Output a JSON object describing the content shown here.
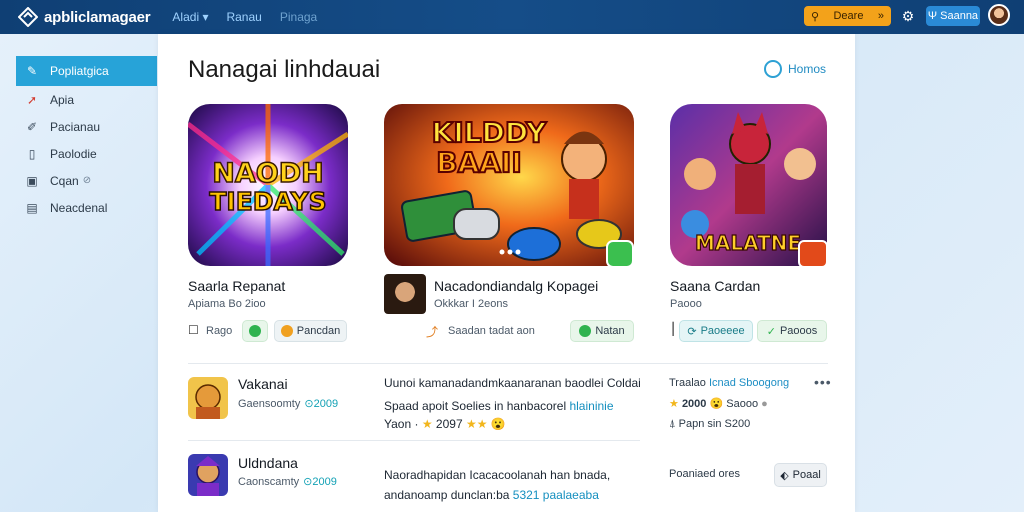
{
  "topbar": {
    "brand": "apbliclamagaer",
    "nav": [
      "Aladi",
      "Ranau",
      "Pinaga"
    ],
    "search_label": "Deare",
    "user_label": "Saanna"
  },
  "sidebar": {
    "items": [
      {
        "label": "Popliatgica",
        "icon": "pencil-icon"
      },
      {
        "label": "Apia",
        "icon": "arrow-icon"
      },
      {
        "label": "Pacianau",
        "icon": "edit-icon"
      },
      {
        "label": "Paolodie",
        "icon": "document-icon"
      },
      {
        "label": "Cqan",
        "extra": "⊘",
        "icon": "calendar-icon"
      },
      {
        "label": "Neacdenal",
        "icon": "table-icon"
      }
    ]
  },
  "main": {
    "title": "Nanagai linhdauai",
    "home_link": "Homos"
  },
  "cards": [
    {
      "name": "Saarla Repanat",
      "sub": "Apiama  Bo  2ioo",
      "chip_plain": "Rago",
      "chip_badge": "Pancdan",
      "art_text": [
        "NAODH",
        "TIEDAYS"
      ]
    },
    {
      "name": "Nacadondiandalg  Kopagei",
      "sub": "Okkkar  I  2eons",
      "meta": "Saadan  tadat aon",
      "chip": "Natan",
      "art_text": [
        "KILDDY",
        "BAAII"
      ]
    },
    {
      "name": "Saana  Cardan",
      "sub": "Paooo",
      "chip1": "Paoeeee",
      "chip2": "Paooos",
      "art_text": [
        "MALATNE"
      ]
    }
  ],
  "list": [
    {
      "name": "Vakanai",
      "sub": "Gaensoomty",
      "sub_accent": "2009",
      "desc1": "Uunoi kamanadandmkaanaranan baodlei Coldai",
      "desc2_pre": "Spaad apoit Soelies in hanbacorel ",
      "desc2_acc": "hlaininie",
      "desc3": "Yaon",
      "desc3_score": "2097",
      "right_title": "Traalao",
      "right_title_acc": "Icnad Sboogong",
      "right_score": "2000",
      "right_tag": "Saooo",
      "right_line2": "Papn  sin  S200"
    },
    {
      "name": "Uldndana",
      "sub": "Caonscamty",
      "sub_accent": "2009",
      "desc1": "Naoradhapidan Icacacoolanah han bnada,",
      "desc2_pre": "andanoamp dunclan:ba ",
      "desc2_acc": "5321 paalaeaba",
      "right_line": "Poaniaed ores",
      "button": "Poaal"
    }
  ]
}
